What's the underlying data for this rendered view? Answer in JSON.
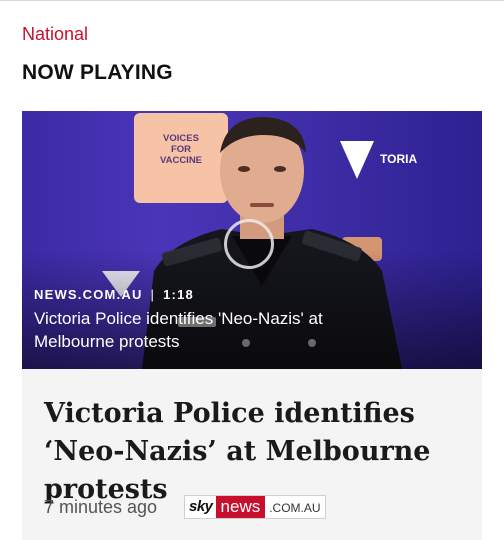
{
  "header": {
    "section": "National",
    "now_playing": "NOW PLAYING"
  },
  "video": {
    "source": "NEWS.COM.AU",
    "duration": "1:18",
    "title": "Victoria Police identifies 'Neo-Nazis' at Melbourne protests",
    "background_signs": [
      "VOICES FOR VACCINE",
      "VICTORIA"
    ]
  },
  "article": {
    "headline": "Victoria Police identifies ‘Neo-Nazis’ at Melbourne protests",
    "time_ago": "7 minutes ago",
    "brand": {
      "sky": "sky",
      "news": "news",
      "domain": ".COM.AU"
    }
  },
  "colors": {
    "accent": "#c8102e",
    "video_bg": "#3f2ea8",
    "card_bg": "#f4f4f4"
  },
  "icons": [
    "play-ring-icon"
  ]
}
